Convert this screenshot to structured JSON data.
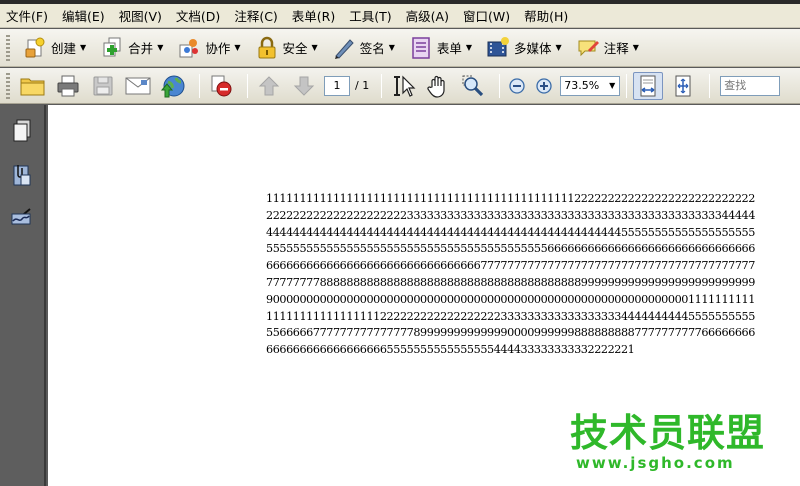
{
  "menu": [
    "文件(F)",
    "编辑(E)",
    "视图(V)",
    "文档(D)",
    "注释(C)",
    "表单(R)",
    "工具(T)",
    "高级(A)",
    "窗口(W)",
    "帮助(H)"
  ],
  "tasks": {
    "create": "创建",
    "combine": "合并",
    "collaborate": "协作",
    "secure": "安全",
    "sign": "签名",
    "forms": "表单",
    "multimedia": "多媒体",
    "comment": "注释"
  },
  "nav": {
    "page": "1",
    "total": "/ 1"
  },
  "zoom": "73.5%",
  "search": {
    "placeholder": "查找"
  },
  "document": {
    "text": "1111111111111111111111111111111111111111111111222222222222222222222222222222222222222222222222333333333333333333333333333333333333333333333334444444444444444444444444444444444444444444444444444444444555555555555555555555555555555555555555555555555555555555555556666666666666666666666666666666666666666666666666666666666666667777777777777777777777777777777777777777777777777888888888888888888888888888888888888888999999999999999999999999999000000000000000000000000000000000000000000000000000000000000001111111111111111111111111112222222222222222223333333333333333334444444444555555555555666667777777777777778999999999999900009999998888888887777777777666666666666666666666666665555555555555555444433333333332222221"
  },
  "watermark": {
    "title": "技术员联盟",
    "url": "www.jsgho.com"
  }
}
